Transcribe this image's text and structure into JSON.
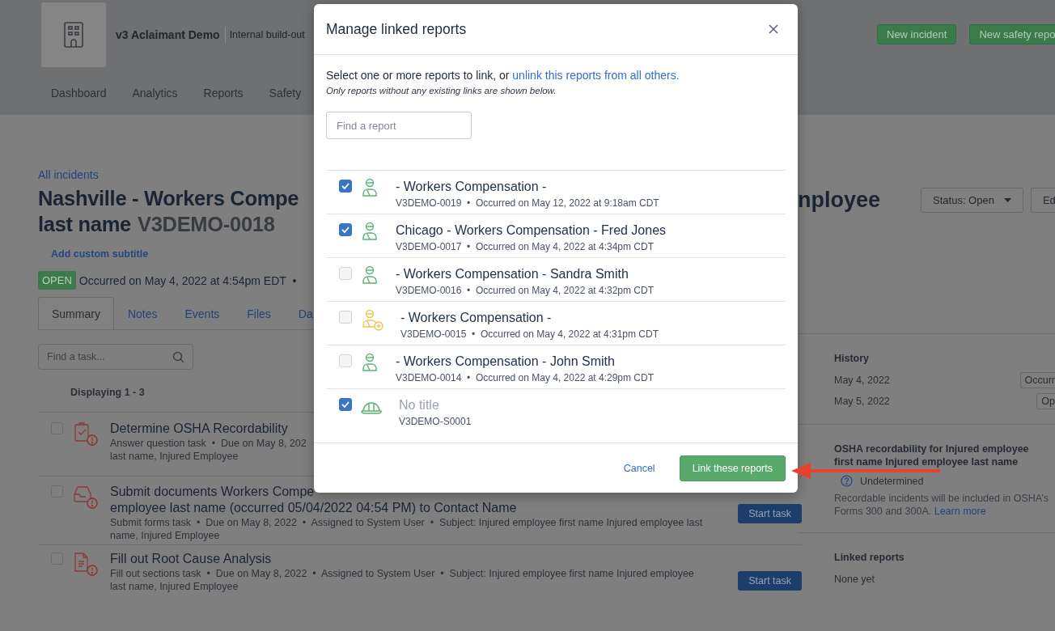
{
  "header": {
    "brand": "v3 Aclaimant Demo",
    "workspace": "Internal build-out",
    "nav": [
      {
        "label": "Dashboard"
      },
      {
        "label": "Analytics"
      },
      {
        "label": "Reports"
      },
      {
        "label": "Safety"
      }
    ],
    "actions": [
      "New incident",
      "New safety repo"
    ]
  },
  "incident": {
    "breadcrumb": "All incidents",
    "title_line_1": "Nashville - Workers Compe",
    "title_line_2": "last name",
    "report_id": "V3DEMO-0018",
    "title_tail": "nployee",
    "subtitle_link": "Add custom subtitle",
    "status_badge": "OPEN",
    "occurred": "Occurred on May 4, 2022 at 4:54pm EDT  •",
    "status_button": "Status: Open",
    "edit_button": "Ed"
  },
  "tabs": [
    {
      "label": "Summary",
      "selected": true
    },
    {
      "label": "Notes",
      "selected": false
    },
    {
      "label": "Events",
      "selected": false
    },
    {
      "label": "Files",
      "selected": false
    },
    {
      "label": "Da",
      "selected": false
    }
  ],
  "tasks": {
    "search_placeholder": "Find a task...",
    "count": "Displaying 1 - 3",
    "items": [
      {
        "kind": "question",
        "checked": false,
        "title_lines": [
          "Determine OSHA Recordability"
        ],
        "meta_lines": [
          "Answer question task  •  Due on May 8, 202",
          "last name, Injured Employee"
        ]
      },
      {
        "kind": "forms",
        "checked": false,
        "title_lines": [
          "Submit documents Workers Compe",
          "employee last name (occurred 05/04/2022 04:54 PM) to Contact Name"
        ],
        "meta_lines": [
          "Submit forms task  •  Due on May 8, 2022  •  Assigned to System User  •  Subject: Injured employee first name Injured employee last",
          "name, Injured Employee"
        ],
        "button": "Start task"
      },
      {
        "kind": "sections",
        "checked": false,
        "title_lines": [
          "Fill out Root Cause Analysis"
        ],
        "meta_lines": [
          "Fill out sections task  •  Due on May 8, 2022  •  Assigned to System User  •  Subject: Injured employee first name Injured employee",
          "last name, Injured Employee"
        ],
        "button": "Start task"
      }
    ]
  },
  "sidebar": {
    "history": {
      "title": "History",
      "rows": [
        {
          "date": "May 4, 2022",
          "badge": "Occurr"
        },
        {
          "date": "May 5, 2022",
          "badge": "Op"
        }
      ]
    },
    "osha": {
      "title": "OSHA recordability for Injured employee first name Injured employee last name",
      "status": "Undetermined",
      "note": "Recordable incidents will be included in OSHA’s Forms 300 and 300A.",
      "link": "Learn more"
    },
    "linked": {
      "title": "Linked reports",
      "value": "None yet"
    }
  },
  "modal": {
    "title": "Manage linked reports",
    "intro": "Select one or more reports to link, or",
    "intro_link": "unlink this reports from all others.",
    "hint": "Only reports without any existing links are shown below.",
    "search_placeholder": "Find a report",
    "reports": [
      {
        "kind": "worker",
        "checked": true,
        "muted": false,
        "title": "- Workers Compensation -",
        "meta": "V3DEMO-0019  •  Occurred on May 12, 2022 at 9:18am CDT"
      },
      {
        "kind": "worker",
        "checked": true,
        "muted": false,
        "title": "Chicago - Workers Compensation - Fred Jones",
        "meta": "V3DEMO-0017  •  Occurred on May 4, 2022 at 4:34pm CDT"
      },
      {
        "kind": "worker",
        "checked": false,
        "muted": false,
        "title": "- Workers Compensation - Sandra Smith",
        "meta": "V3DEMO-0016  •  Occurred on May 4, 2022 at 4:32pm CDT"
      },
      {
        "kind": "worker-pending",
        "checked": false,
        "muted": false,
        "title": "- Workers Compensation -",
        "meta": "V3DEMO-0015  •  Occurred on May 4, 2022 at 4:31pm CDT"
      },
      {
        "kind": "worker",
        "checked": false,
        "muted": false,
        "title": "- Workers Compensation - John Smith",
        "meta": "V3DEMO-0014  •  Occurred on May 4, 2022 at 4:29pm CDT"
      },
      {
        "kind": "hardhat",
        "checked": true,
        "muted": true,
        "title": "No title",
        "meta": "V3DEMO-S0001"
      }
    ],
    "cancel": "Cancel",
    "submit": "Link these reports"
  }
}
